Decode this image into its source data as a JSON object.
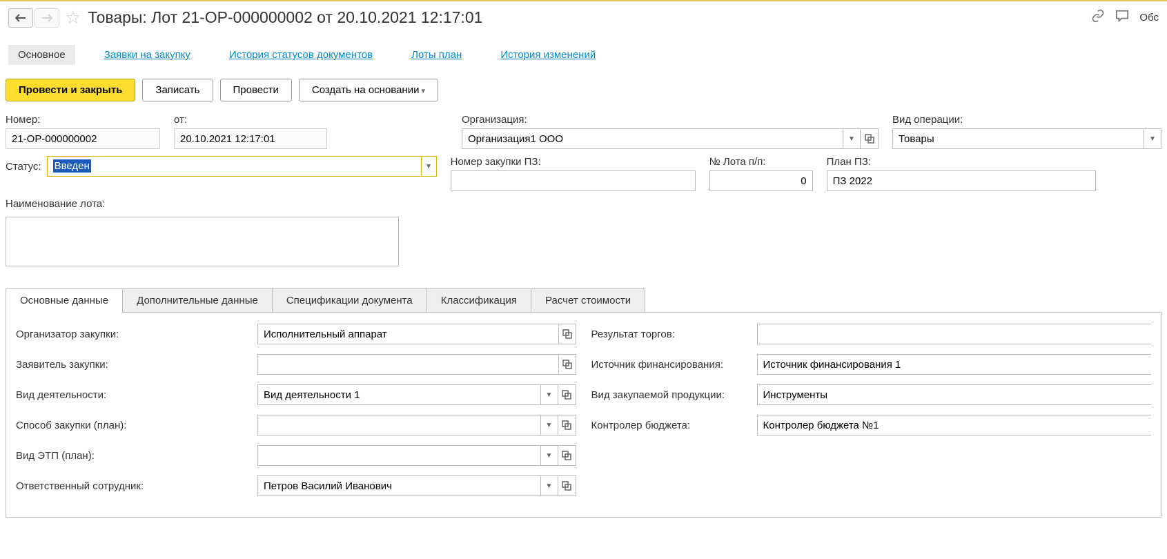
{
  "header": {
    "title": "Товары: Лот 21-ОР-000000002 от 20.10.2021 12:17:01",
    "discuss": "Обс"
  },
  "navTabs": {
    "main": "Основное",
    "requests": "Заявки на закупку",
    "statusHistory": "История статусов документов",
    "lotsPlan": "Лоты план",
    "changeHistory": "История изменений"
  },
  "toolbar": {
    "postAndClose": "Провести и закрыть",
    "save": "Записать",
    "post": "Провести",
    "createBased": "Создать на основании"
  },
  "fields": {
    "numberLabel": "Номер:",
    "numberValue": "21-ОР-000000002",
    "dateLabel": "от:",
    "dateValue": "20.10.2021 12:17:01",
    "orgLabel": "Организация:",
    "orgValue": "Организация1 ООО",
    "opTypeLabel": "Вид операции:",
    "opTypeValue": "Товары",
    "statusLabel": "Статус:",
    "statusValue": "Введен",
    "purchaseNoLabel": "Номер закупки ПЗ:",
    "purchaseNoValue": "",
    "lotNoLabel": "№ Лота п/п:",
    "lotNoValue": "0",
    "planLabel": "План ПЗ:",
    "planValue": "ПЗ 2022",
    "lotNameLabel": "Наименование лота:",
    "lotNameValue": ""
  },
  "detailTabs": {
    "main": "Основные данные",
    "extra": "Дополнительные данные",
    "specs": "Спецификации документа",
    "classification": "Классификация",
    "costCalc": "Расчет стоимости"
  },
  "mainData": {
    "organizerLabel": "Организатор закупки:",
    "organizerValue": "Исполнительный аппарат",
    "applicantLabel": "Заявитель закупки:",
    "applicantValue": "",
    "activityLabel": "Вид деятельности:",
    "activityValue": "Вид деятельности 1",
    "purchaseMethodLabel": "Способ закупки (план):",
    "purchaseMethodValue": "",
    "etpTypeLabel": "Вид ЭТП (план):",
    "etpTypeValue": "",
    "responsibleLabel": "Ответственный сотрудник:",
    "responsibleValue": "Петров Василий Иванович",
    "bidResultLabel": "Результат торгов:",
    "bidResultValue": "",
    "financeSourceLabel": "Источник финансирования:",
    "financeSourceValue": "Источник финансирования 1",
    "productTypeLabel": "Вид закупаемой продукции:",
    "productTypeValue": "Инструменты",
    "budgetControllerLabel": "Контролер бюджета:",
    "budgetControllerValue": "Контролер бюджета №1"
  }
}
